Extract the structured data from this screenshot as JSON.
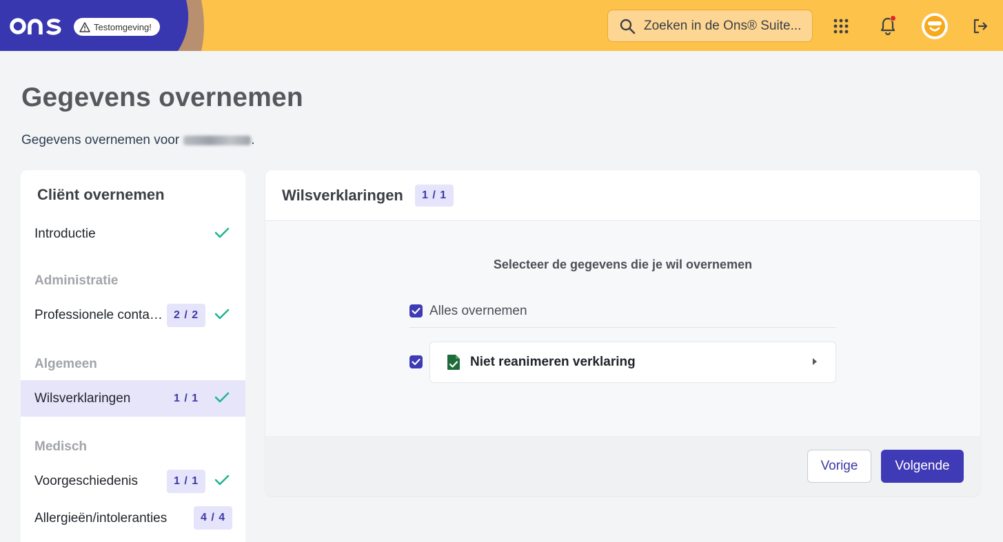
{
  "header": {
    "logo_text": "ons",
    "env_badge": "Testomgeving!",
    "search_placeholder": "Zoeken in de Ons® Suite..."
  },
  "page": {
    "title": "Gegevens overnemen",
    "subtitle_prefix": "Gegevens overnemen voor",
    "subtitle_suffix": "."
  },
  "sidebar": {
    "title": "Cliënt overnemen",
    "items": [
      {
        "label": "Introductie",
        "count": "",
        "done": true
      },
      {
        "group": "Administratie"
      },
      {
        "label": "Professionele contacten",
        "count": "2 / 2",
        "done": true
      },
      {
        "group": "Algemeen"
      },
      {
        "label": "Wilsverklaringen",
        "count": "1 / 1",
        "done": true,
        "active": true
      },
      {
        "group": "Medisch"
      },
      {
        "label": "Voorgeschiedenis",
        "count": "1 / 1",
        "done": true
      },
      {
        "label": "Allergieën/intoleranties",
        "count": "4 / 4",
        "done": false
      }
    ]
  },
  "main": {
    "title": "Wilsverklaringen",
    "count": "1 / 1",
    "instruction": "Selecteer de gegevens die je wil overnemen",
    "select_all_label": "Alles overnemen",
    "select_all_checked": true,
    "records": [
      {
        "label": "Niet reanimeren verklaring",
        "checked": true,
        "icon": "file-check-icon"
      }
    ],
    "prev_label": "Vorige",
    "next_label": "Volgende"
  },
  "colors": {
    "header_bg": "#fdc24a",
    "brand_blue": "#3f3ab5",
    "badge_bg": "#e6e4fb",
    "active_row_bg": "#e7e5fa",
    "check_green": "#1fb58f",
    "file_icon_green": "#1e6b3a",
    "notification_dot": "#e0262d"
  }
}
